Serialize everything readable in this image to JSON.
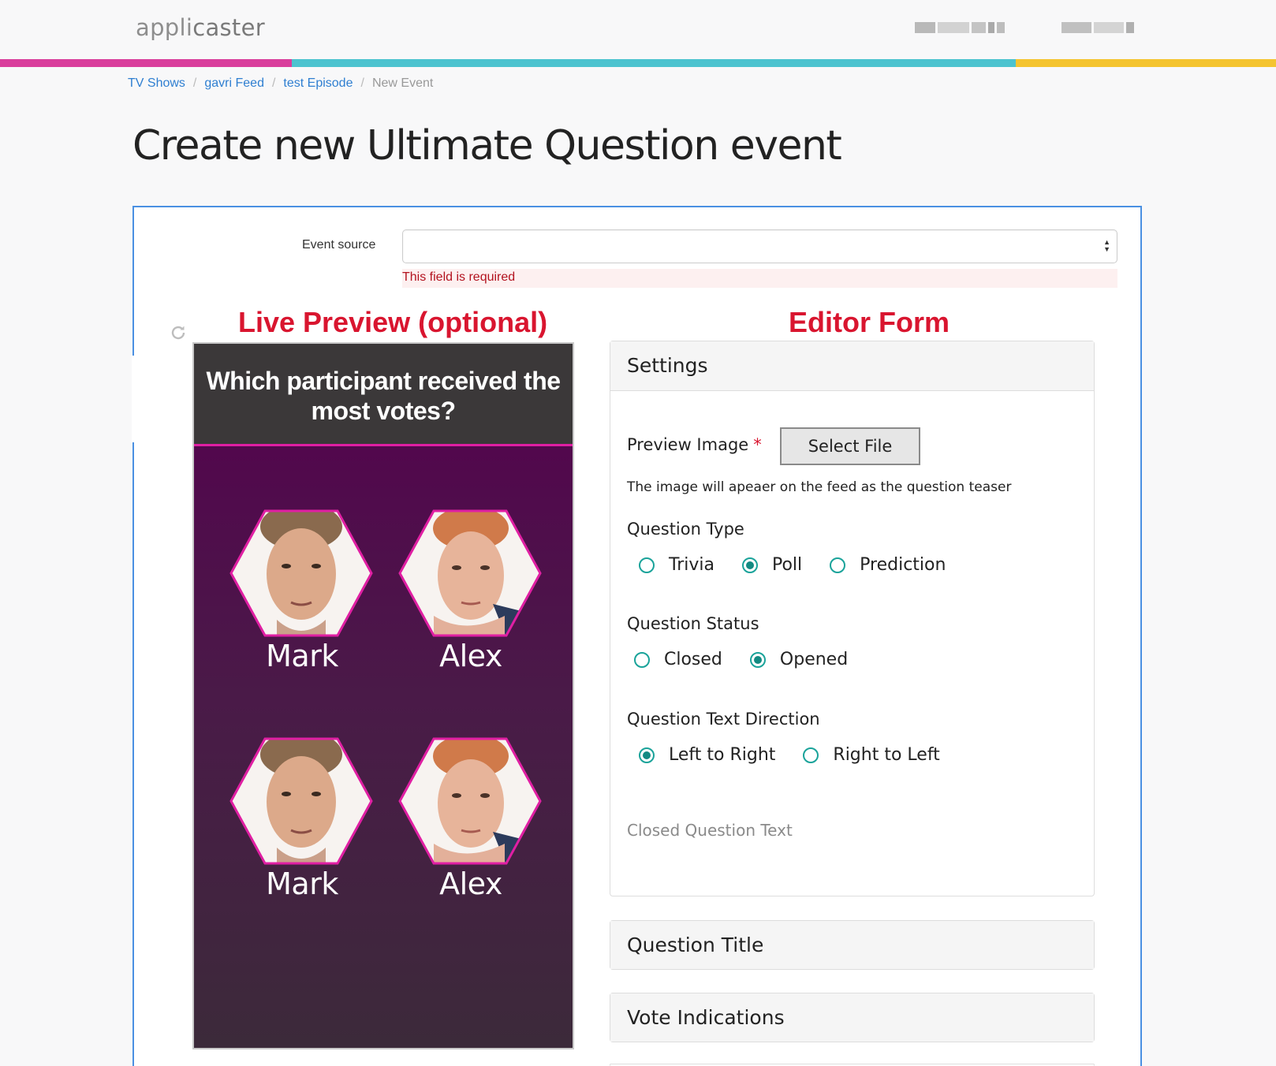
{
  "header": {
    "logo_prefix": "appli",
    "logo_suffix": "caster",
    "brand_colors": [
      "#d93e9c",
      "#4cc3cf",
      "#f4c430"
    ]
  },
  "breadcrumb": {
    "items": [
      "TV Shows",
      "gavri Feed",
      "test Episode"
    ],
    "current": "New Event",
    "separator": "/"
  },
  "page": {
    "title": "Create new Ultimate Question event"
  },
  "event_source": {
    "label": "Event source",
    "value": "",
    "error": "This field is required"
  },
  "annotations": {
    "preview": "Live Preview (optional)",
    "editor": "Editor Form"
  },
  "preview": {
    "question": "Which participant received the most votes?",
    "candidates": [
      {
        "name": "Mark"
      },
      {
        "name": "Alex"
      },
      {
        "name": "Mark"
      },
      {
        "name": "Alex"
      }
    ],
    "accent_color": "#e01fa3"
  },
  "settings": {
    "title": "Settings",
    "preview_image_label": "Preview Image",
    "required_mark": "*",
    "select_file_label": "Select File",
    "preview_image_help": "The image will apeaer on the feed as the question teaser",
    "question_type": {
      "label": "Question Type",
      "options": [
        "Trivia",
        "Poll",
        "Prediction"
      ],
      "selected": "Poll"
    },
    "question_status": {
      "label": "Question Status",
      "options": [
        "Closed",
        "Opened"
      ],
      "selected": "Opened"
    },
    "text_direction": {
      "label": "Question Text Direction",
      "options": [
        "Left to Right",
        "Right to Left"
      ],
      "selected": "Left to Right"
    },
    "closed_question_text_label": "Closed Question Text"
  },
  "panels": {
    "question_title": "Question Title",
    "vote_indications": "Vote Indications"
  },
  "icons": {
    "refresh": "refresh-icon",
    "select_arrows": "chevron-updown-icon"
  }
}
